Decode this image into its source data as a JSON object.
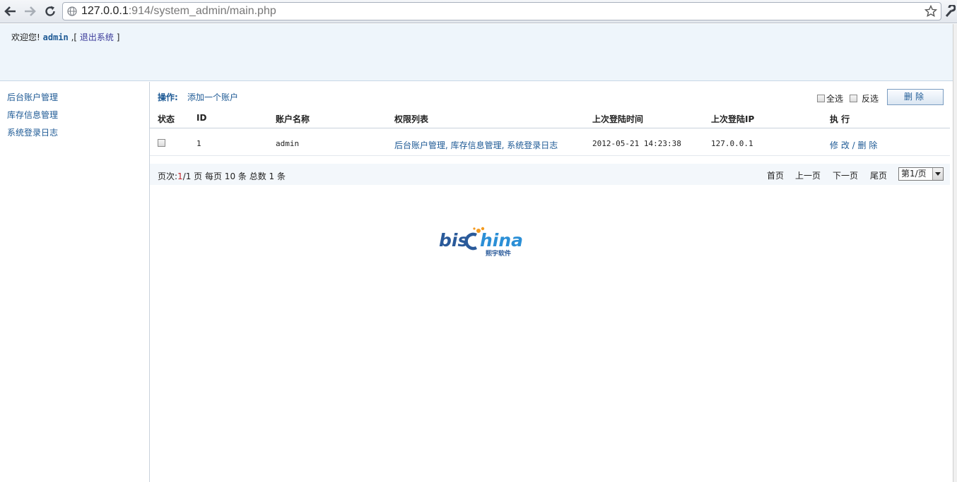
{
  "browser": {
    "url_host": "127.0.0.1",
    "url_rest": ":914/system_admin/main.php"
  },
  "header": {
    "welcome_text": "欢迎您!",
    "username": "admin",
    "separator": " ,[ ",
    "logout_label": "退出系统",
    "close_bracket": " ]"
  },
  "sidebar": {
    "items": [
      {
        "label": "后台账户管理"
      },
      {
        "label": "库存信息管理"
      },
      {
        "label": "系统登录日志"
      }
    ]
  },
  "toolbar": {
    "op_label": "操作:",
    "add_account_label": "添加一个账户",
    "select_all_label": "全选",
    "inverse_label": "反选",
    "delete_label": "删除"
  },
  "table": {
    "headers": [
      "状态",
      "ID",
      "账户名称",
      "权限列表",
      "上次登陆时间",
      "上次登陆IP",
      "执 行"
    ],
    "rows": [
      {
        "id": "1",
        "name": "admin",
        "permissions": "后台账户管理, 库存信息管理, 系统登录日志",
        "last_login_time": "2012-05-21 14:23:38",
        "last_login_ip": "127.0.0.1",
        "edit_label": "修 改",
        "action_sep": " / ",
        "delete_label": "删 除"
      }
    ]
  },
  "pager": {
    "label_prefix": "页次:",
    "current": "1",
    "total_pages_text": "/1 页 每页 10 条 总数 1 条",
    "first": "首页",
    "prev": "上一页",
    "next": "下一页",
    "last": "尾页",
    "select_value": "第1/页"
  },
  "logo": {
    "part1": "bis",
    "part2": "hina",
    "tagline": "熙宇软件"
  },
  "colors": {
    "link": "#1e5a95",
    "header_bg": "#eef5fb",
    "accent_orange": "#f39a1e"
  }
}
